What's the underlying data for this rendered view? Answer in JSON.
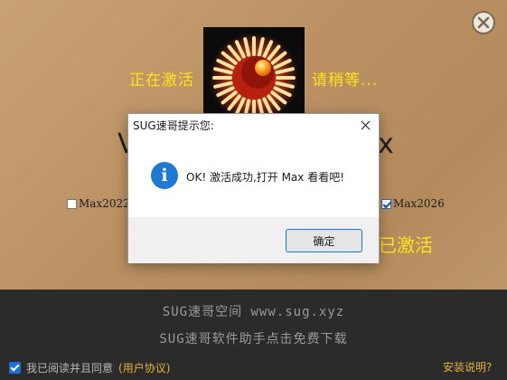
{
  "status": {
    "left": "正在激活",
    "right": "请稍等..."
  },
  "background_text": {
    "left": "V",
    "right": "x"
  },
  "versions": [
    {
      "label": "Max2022",
      "checked": false
    },
    {
      "label": "Max2026",
      "checked": true
    }
  ],
  "activated_text": "已激活",
  "footer": {
    "line1": "SUG速哥空间 www.sug.xyz",
    "line2": "SUG速哥软件助手点击免费下载",
    "agree_prefix": "我已阅读并且同意",
    "agree_link": "(用户协议)",
    "install_help": "安装说明?"
  },
  "dialog": {
    "title": "SUG速哥提示您:",
    "message": "OK! 激活成功,打开 Max 看看吧!",
    "ok_label": "确定",
    "info_glyph": "i"
  },
  "colors": {
    "accent_yellow": "#ffe21c",
    "link_orange": "#e3b23c",
    "info_blue": "#1f78d1"
  },
  "icons": [
    "close-icon",
    "activation-logo",
    "info-icon",
    "checkbox-icon"
  ]
}
